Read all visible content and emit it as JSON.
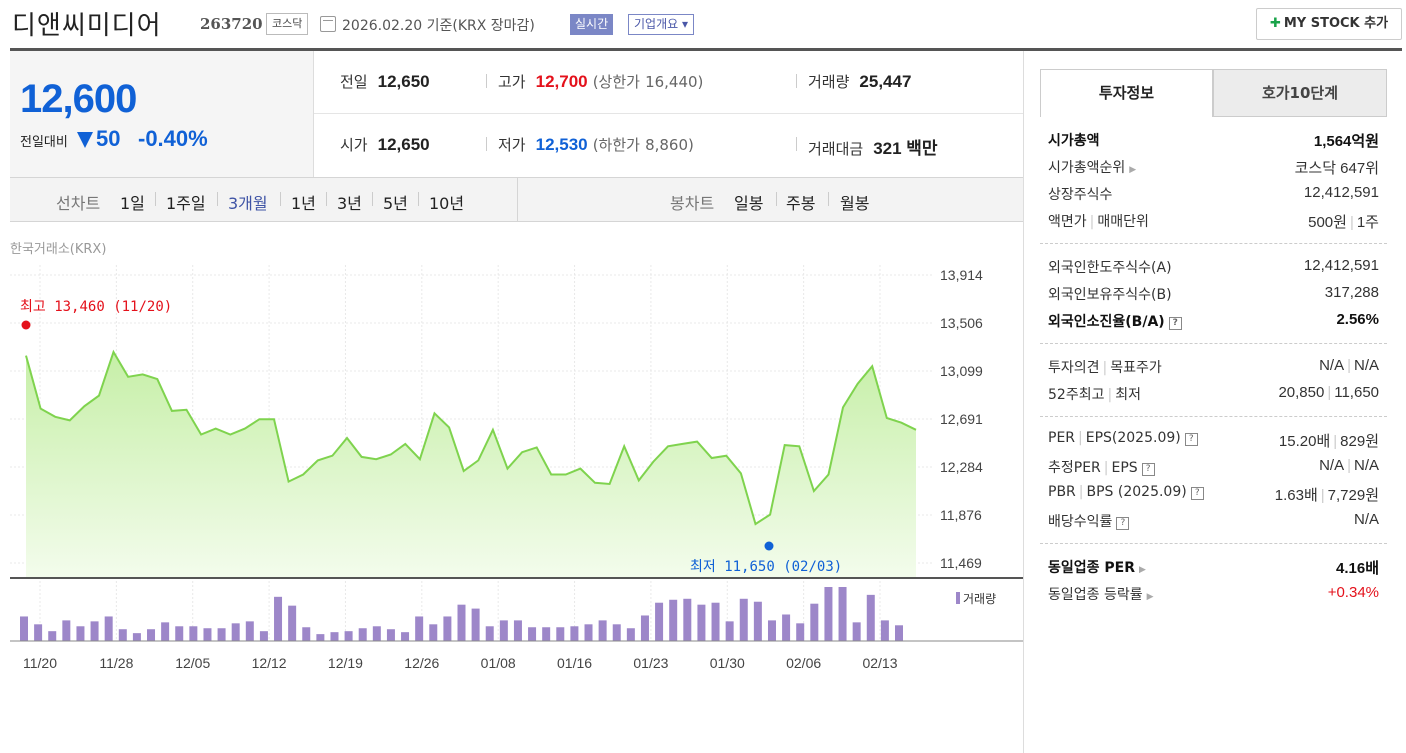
{
  "header": {
    "name": "디앤씨미디어",
    "code": "263720",
    "market": "코스닥",
    "date": "2026.02.20 기준(KRX 장마감)",
    "realtime": "실시간",
    "overview": "기업개요 ▾",
    "mystock_label": "MY STOCK 추가"
  },
  "price": {
    "now": "12,600",
    "diff_label": "전일대비",
    "diff": "50",
    "pct": "-0.40%"
  },
  "stats": {
    "prev_label": "전일",
    "prev": "12,650",
    "high_label": "고가",
    "high": "12,700",
    "upper_label": "(상한가",
    "upper": "16,440)",
    "volume_label": "거래량",
    "volume": "25,447",
    "open_label": "시가",
    "open": "12,650",
    "low_label": "저가",
    "low": "12,530",
    "lower_label": "(하한가",
    "lower": "8,860)",
    "amount_label": "거래대금",
    "amount": "321 백만"
  },
  "period": {
    "line_label": "선차트",
    "line_items": [
      "1일",
      "1주일",
      "3개월",
      "1년",
      "3년",
      "5년",
      "10년"
    ],
    "active": "3개월",
    "candle_label": "봉차트",
    "candle_items": [
      "일봉",
      "주봉",
      "월봉"
    ]
  },
  "chart": {
    "exchange": "한국거래소(KRX)",
    "high_label": "최고 13,460 (11/20)",
    "low_label": "최저 11,650 (02/03)",
    "volume_legend": "거래량",
    "colors": {
      "line": "#7fd34e",
      "fill_top": "#c6efa7",
      "fill_bottom": "#f3fcec",
      "volume": "#9d87c9",
      "high": "#e4111b",
      "low": "#1061d6"
    }
  },
  "chart_data": {
    "type": "area",
    "y_ticks": [
      "13,914",
      "13,506",
      "13,099",
      "12,691",
      "12,284",
      "11,876",
      "11,469"
    ],
    "ylim": [
      11469,
      13914
    ],
    "x_ticks": [
      "11/20",
      "11/28",
      "12/05",
      "12/12",
      "12/19",
      "12/26",
      "01/08",
      "01/16",
      "01/23",
      "01/30",
      "02/06",
      "02/13"
    ],
    "prices": [
      13230,
      12780,
      12710,
      12680,
      12800,
      12890,
      13260,
      13050,
      13070,
      13030,
      12760,
      12770,
      12560,
      12610,
      12560,
      12610,
      12690,
      12690,
      12160,
      12220,
      12340,
      12380,
      12530,
      12370,
      12350,
      12390,
      12480,
      12350,
      12740,
      12620,
      12250,
      12340,
      12600,
      12270,
      12410,
      12450,
      12220,
      12220,
      12270,
      12150,
      12140,
      12460,
      12170,
      12330,
      12460,
      12480,
      12500,
      12360,
      12380,
      12230,
      11800,
      11880,
      12470,
      12460,
      12080,
      12220,
      12790,
      12990,
      13140,
      12700,
      12660,
      12600
    ],
    "volumes": [
      0.25,
      0.17,
      0.1,
      0.21,
      0.15,
      0.2,
      0.25,
      0.12,
      0.08,
      0.12,
      0.19,
      0.15,
      0.15,
      0.13,
      0.13,
      0.18,
      0.2,
      0.1,
      0.45,
      0.36,
      0.14,
      0.07,
      0.09,
      0.1,
      0.13,
      0.15,
      0.12,
      0.09,
      0.25,
      0.17,
      0.25,
      0.37,
      0.33,
      0.15,
      0.21,
      0.21,
      0.14,
      0.14,
      0.14,
      0.15,
      0.17,
      0.21,
      0.17,
      0.13,
      0.26,
      0.39,
      0.42,
      0.43,
      0.37,
      0.39,
      0.2,
      0.43,
      0.4,
      0.21,
      0.27,
      0.18,
      0.38,
      0.55,
      0.55,
      0.19,
      0.47,
      0.21,
      0.16
    ],
    "high": {
      "date": "11/20",
      "value": 13460
    },
    "low": {
      "date": "02/03",
      "value": 11650
    }
  },
  "invest": {
    "tab1": "투자정보",
    "tab2": "호가10단계",
    "market_cap_label": "시가총액",
    "market_cap": "1,564억원",
    "cap_rank_label": "시가총액순위",
    "cap_rank": "코스닥 647위",
    "shares_label": "상장주식수",
    "shares": "12,412,591",
    "par_label": "액면가",
    "unit_label": "매매단위",
    "par": "500원",
    "unit": "1주",
    "foreign_limit_label": "외국인한도주식수(A)",
    "foreign_limit": "12,412,591",
    "foreign_hold_label": "외국인보유주식수(B)",
    "foreign_hold": "317,288",
    "foreign_ratio_label": "외국인소진율(B/A)",
    "foreign_ratio": "2.56%",
    "opinion_label": "투자의견",
    "target_label": "목표주가",
    "opinion": "N/A",
    "target": "N/A",
    "w52_high_label": "52주최고",
    "w52_low_label": "최저",
    "w52_high": "20,850",
    "w52_low": "11,650",
    "per_label": "PER",
    "eps_label": "EPS(2025.09)",
    "per": "15.20배",
    "eps": "829원",
    "est_per_label": "추정PER",
    "est_eps_label": "EPS",
    "est_per": "N/A",
    "est_eps": "N/A",
    "pbr_label": "PBR",
    "bps_label": "BPS (2025.09)",
    "pbr": "1.63배",
    "bps": "7,729원",
    "div_label": "배당수익률",
    "div": "N/A",
    "ind_per_label": "동일업종 PER",
    "ind_per": "4.16배",
    "ind_change_label": "동일업종 등락률",
    "ind_change": "+0.34%"
  }
}
